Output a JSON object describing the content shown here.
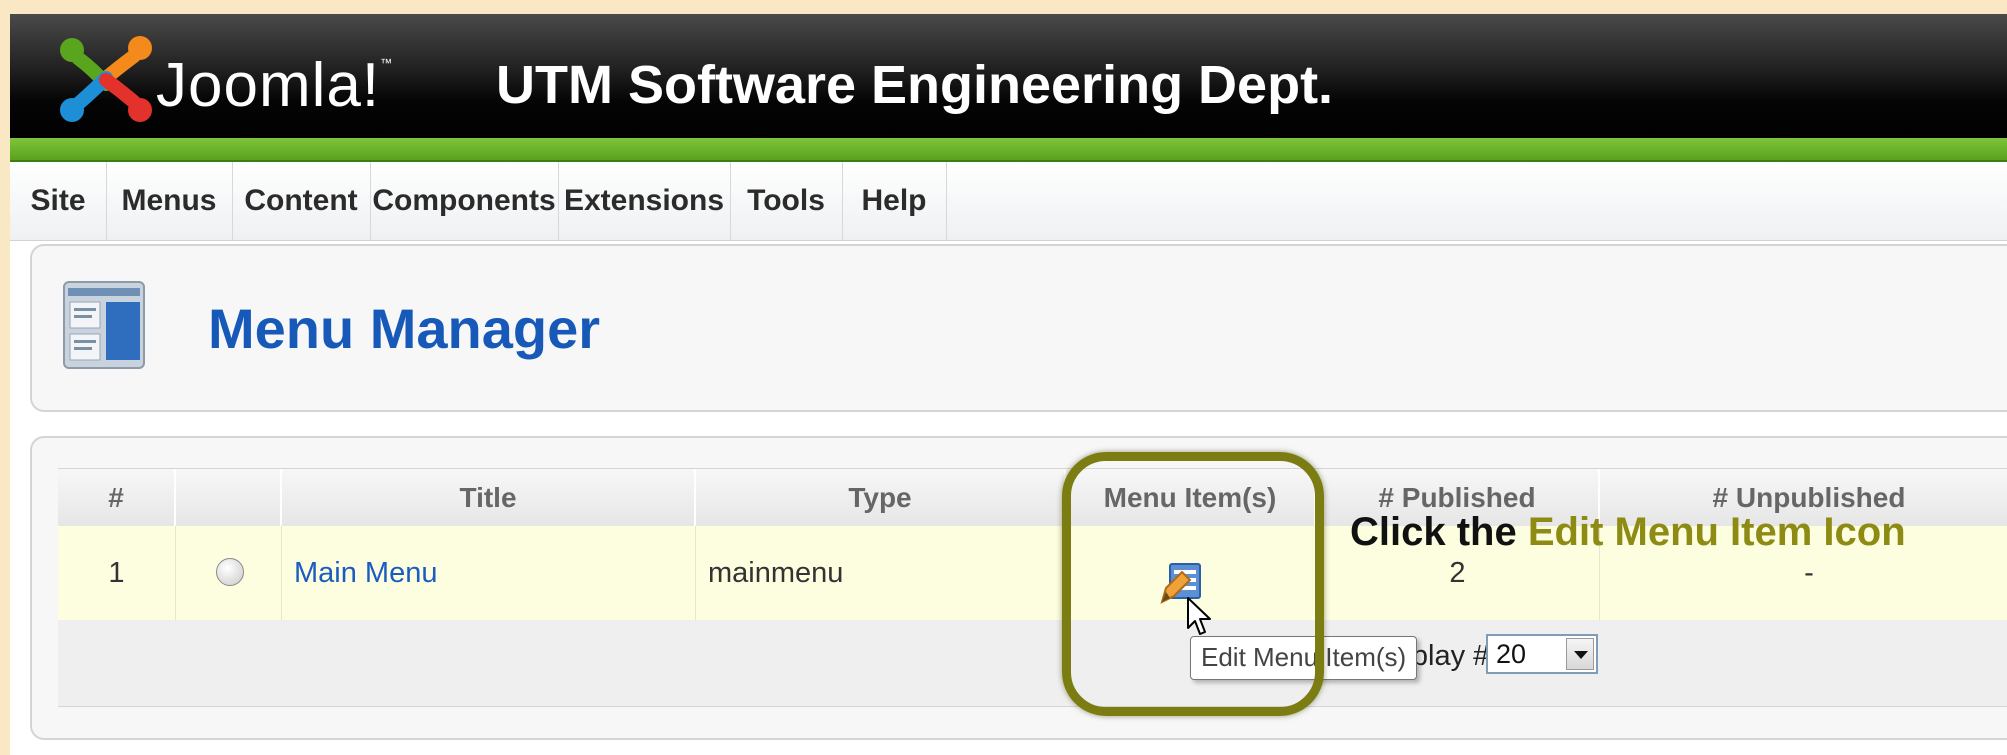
{
  "header": {
    "logo_text": "Joomla!",
    "logo_tm": "™",
    "site_title": "UTM Software Engineering Dept."
  },
  "menu": {
    "items": [
      {
        "label": "Site"
      },
      {
        "label": "Menus"
      },
      {
        "label": "Content"
      },
      {
        "label": "Components"
      },
      {
        "label": "Extensions"
      },
      {
        "label": "Tools"
      },
      {
        "label": "Help"
      }
    ]
  },
  "page": {
    "title": "Menu Manager"
  },
  "table": {
    "columns": [
      "#",
      "",
      "Title",
      "Type",
      "Menu Item(s)",
      "# Published",
      "# Unpublished"
    ],
    "rows": [
      {
        "num": "1",
        "title": "Main Menu",
        "type": "mainmenu",
        "published": "2",
        "unpublished": "-"
      }
    ],
    "display_label": "Display #",
    "display_value": "20"
  },
  "tooltip": {
    "text": "Edit Menu Item(s)"
  },
  "annotation": {
    "prefix": "Click the ",
    "highlight": "Edit Menu Item Icon"
  },
  "colors": {
    "accent_green": "#6ab42a",
    "title_blue": "#1759b8",
    "highlight_olive": "#7b7d12"
  }
}
